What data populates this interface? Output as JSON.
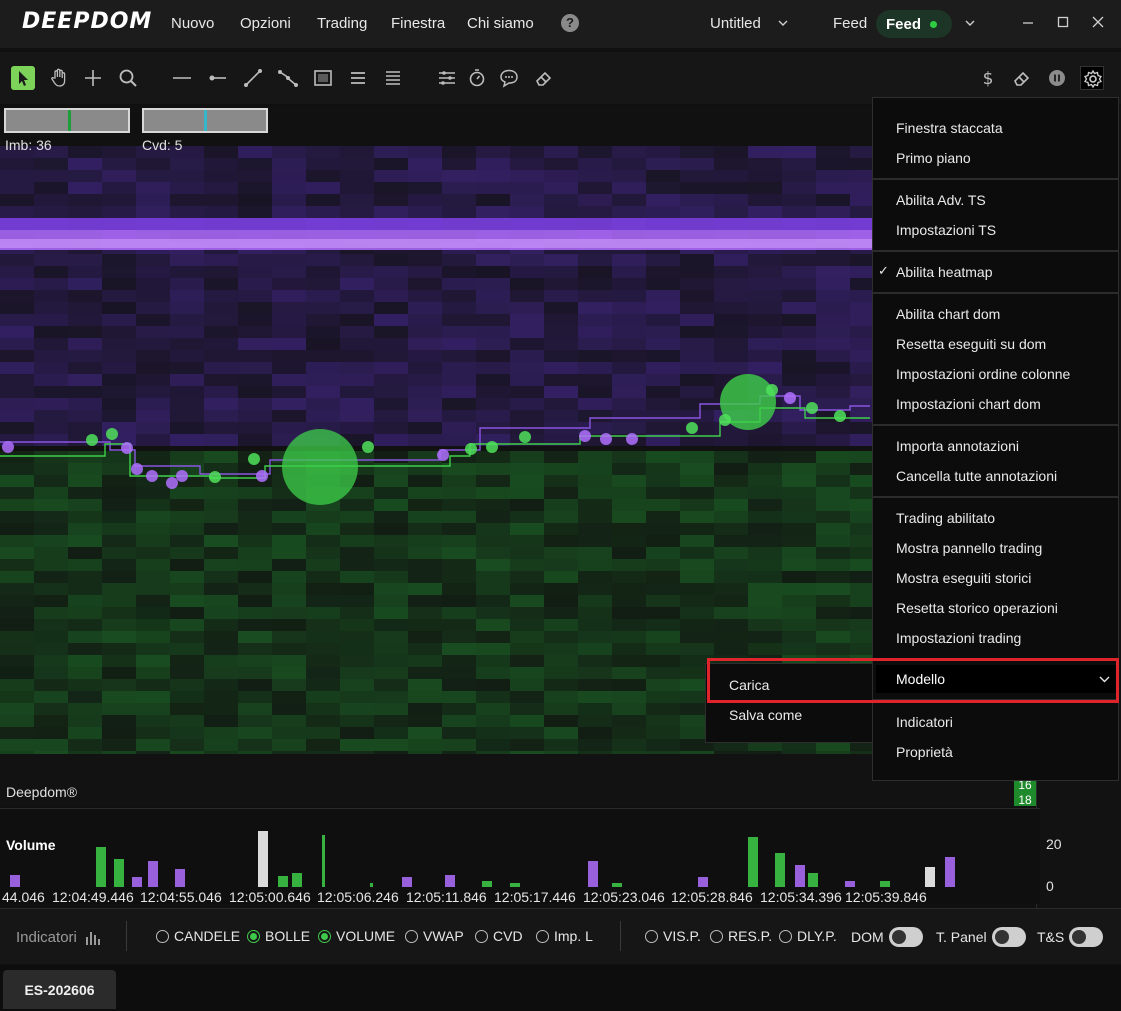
{
  "app": {
    "logo": "DEEPDOM",
    "menu": [
      "Nuovo",
      "Opzioni",
      "Trading",
      "Finestra",
      "Chi siamo"
    ],
    "help_icon": "question-circle-icon",
    "workspace_name": "Untitled",
    "feed_label": "Feed",
    "feed_pill_label": "Feed",
    "feed_status_color": "#2ecc40",
    "window_controls": [
      "minimize-icon",
      "maximize-icon",
      "close-icon"
    ]
  },
  "toolbar": {
    "tools": [
      "pointer-icon",
      "hand-icon",
      "crosshair-icon",
      "zoom-icon",
      "horizontal-line-icon",
      "horizontal-ray-icon",
      "trend-line-icon",
      "multi-point-line-icon",
      "rectangle-icon",
      "hamburger-icon",
      "list-icon",
      "sliders-icon",
      "stopwatch-icon",
      "comment-icon",
      "eraser-icon"
    ],
    "right_tools": [
      "dollar-icon",
      "eraser-icon",
      "pause-icon",
      "gear-icon"
    ],
    "accent_color": "#7dd35a"
  },
  "chart": {
    "imb_label": "Imb: 36",
    "cvd_label": "Cvd: 5",
    "brand": "Deepdom®",
    "price_tags": [
      "16",
      "18"
    ]
  },
  "volume_panel": {
    "title": "Volume",
    "axis_values": [
      "20",
      "0"
    ],
    "time_labels": [
      "44.046",
      "12:04:49.446",
      "12:04:55.046",
      "12:05:00.646",
      "12:05:06.246",
      "12:05:11.846",
      "12:05:17.446",
      "12:05:23.046",
      "12:05:28.846",
      "12:05:34.396",
      "12:05:39.846"
    ]
  },
  "bottombar": {
    "indicatori_label": "Indicatori",
    "options": [
      {
        "label": "CANDELE",
        "on": false
      },
      {
        "label": "BOLLE",
        "on": true
      },
      {
        "label": "VOLUME",
        "on": true
      },
      {
        "label": "VWAP",
        "on": false
      },
      {
        "label": "CVD",
        "on": false
      },
      {
        "label": "Imp. L",
        "on": false
      }
    ],
    "options2": [
      {
        "label": "VIS.P.",
        "on": false
      },
      {
        "label": "RES.P.",
        "on": false
      },
      {
        "label": "DLY.P.",
        "on": false
      }
    ],
    "toggles": [
      "DOM",
      "T. Panel",
      "T&S"
    ]
  },
  "tabs": [
    "ES-202606"
  ],
  "context_menu": {
    "groups": [
      [
        "Finestra staccata",
        "Primo piano"
      ],
      [
        "Abilita Adv. TS",
        "Impostazioni TS"
      ],
      [
        "Abilita heatmap"
      ],
      [
        "Abilita chart dom",
        "Resetta eseguiti su dom",
        "Impostazioni ordine colonne",
        "Impostazioni chart dom"
      ],
      [
        "Importa annotazioni",
        "Cancella tutte annotazioni"
      ],
      [
        "Trading abilitato",
        "Mostra pannello trading",
        "Mostra eseguiti storici",
        "Resetta storico operazioni",
        "Impostazioni trading"
      ],
      [
        "Modello"
      ],
      [
        "Indicatori",
        "Proprietà"
      ]
    ],
    "checked_item": "Abilita heatmap",
    "check_mark": "✓",
    "highlight_color": "#e0242b"
  },
  "submenu": {
    "items": [
      "Carica",
      "Salva come"
    ]
  }
}
